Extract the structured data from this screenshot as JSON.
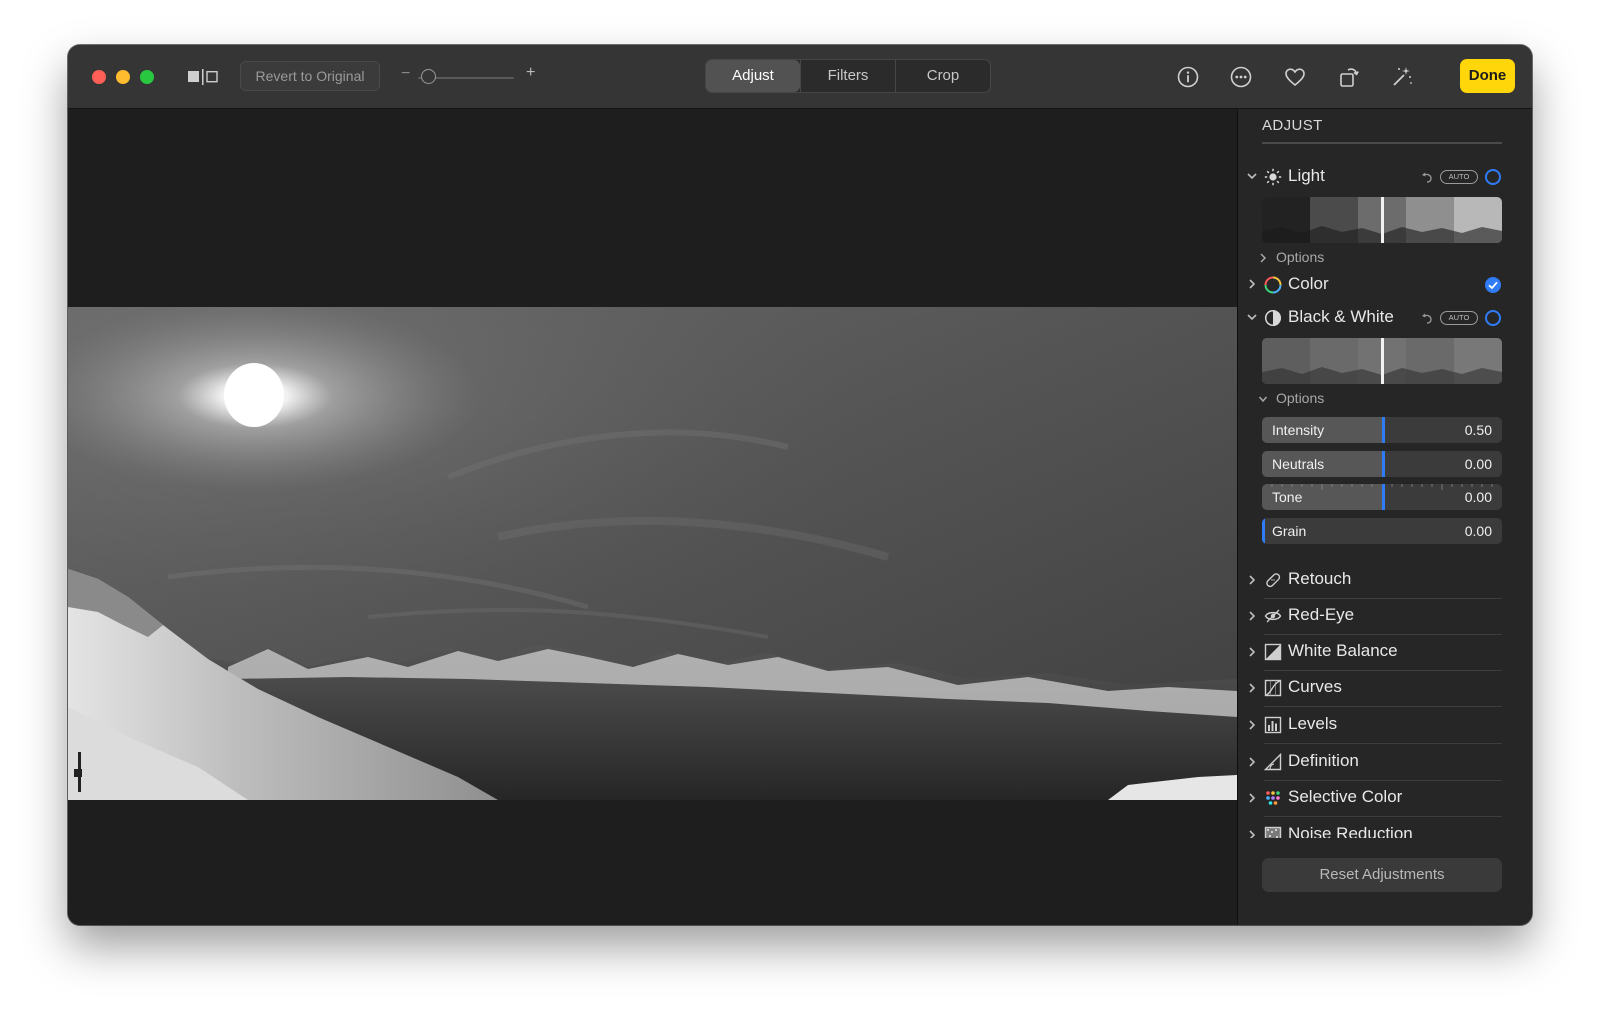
{
  "toolbar": {
    "revert_label": "Revert to Original",
    "zoom_minus": "−",
    "zoom_plus": "+",
    "tabs": [
      {
        "label": "Adjust",
        "active": true
      },
      {
        "label": "Filters",
        "active": false
      },
      {
        "label": "Crop",
        "active": false
      }
    ],
    "icons": [
      "info-icon",
      "more-icon",
      "heart-icon",
      "rotate-icon",
      "magic-wand-icon"
    ],
    "done_label": "Done"
  },
  "colors": {
    "accent": "#2f7cf6",
    "done": "#fed60a",
    "window_bg": "#1e1e1e",
    "sidebar_bg": "#262626",
    "toolbar_bg": "#353535"
  },
  "sidebar": {
    "title": "ADJUST",
    "light": {
      "label": "Light",
      "auto": "AUTO",
      "options_label": "Options",
      "expanded": true
    },
    "color": {
      "label": "Color",
      "checked": true
    },
    "bw": {
      "label": "Black & White",
      "auto": "AUTO",
      "options_label": "Options",
      "expanded": true
    },
    "sliders": [
      {
        "name": "Intensity",
        "value": "0.50",
        "fraction": 0.5
      },
      {
        "name": "Neutrals",
        "value": "0.00",
        "fraction": 0.5
      },
      {
        "name": "Tone",
        "value": "0.00",
        "fraction": 0.5
      },
      {
        "name": "Grain",
        "value": "0.00",
        "fraction": 0.0
      }
    ],
    "tools": [
      {
        "label": "Retouch",
        "icon": "bandage-icon"
      },
      {
        "label": "Red-Eye",
        "icon": "eye-icon"
      },
      {
        "label": "White Balance",
        "icon": "white-balance-icon"
      },
      {
        "label": "Curves",
        "icon": "curves-icon"
      },
      {
        "label": "Levels",
        "icon": "levels-icon"
      },
      {
        "label": "Definition",
        "icon": "definition-icon"
      },
      {
        "label": "Selective Color",
        "icon": "selective-color-icon"
      },
      {
        "label": "Noise Reduction",
        "icon": "noise-reduction-icon"
      }
    ],
    "reset_label": "Reset Adjustments"
  }
}
